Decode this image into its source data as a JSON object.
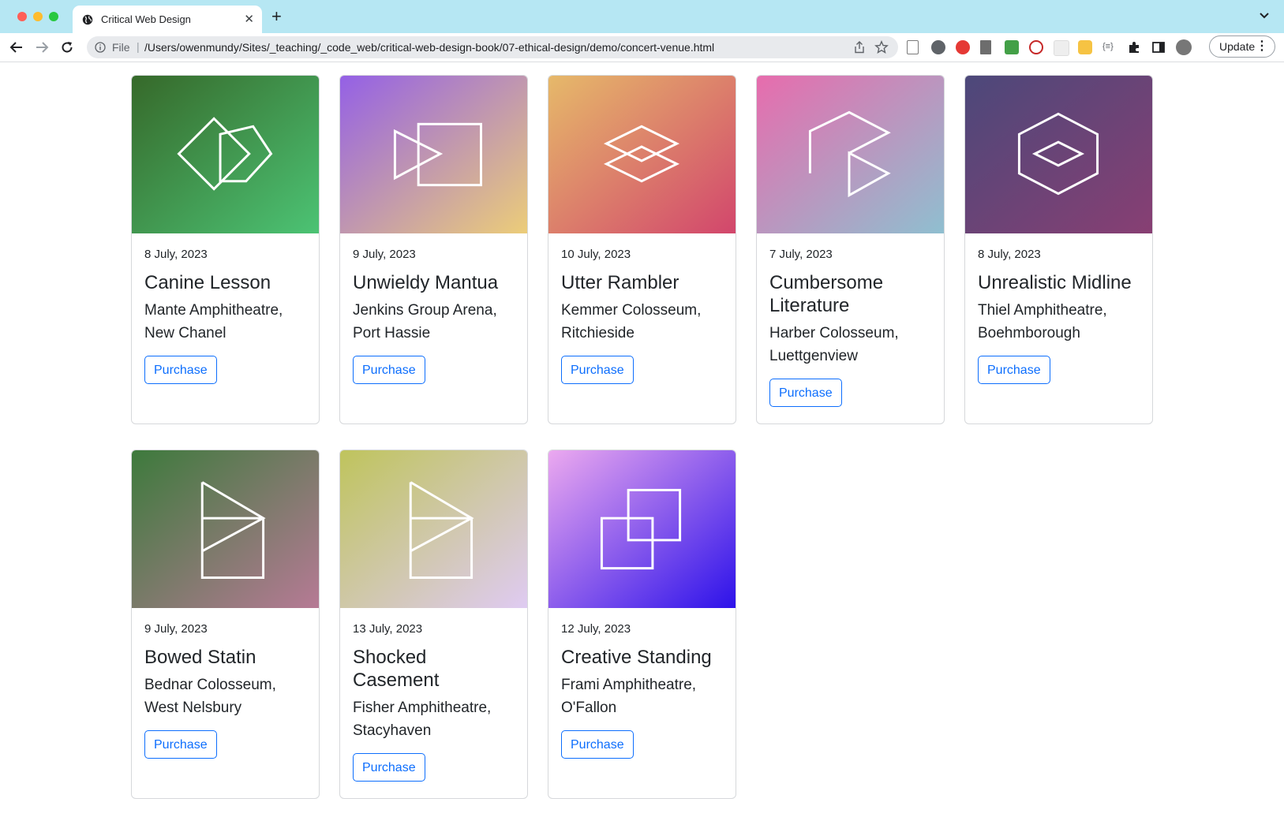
{
  "browser": {
    "tab_title": "Critical Web Design",
    "scheme": "File",
    "url": "/Users/owenmundy/Sites/_teaching/_code_web/critical-web-design-book/07-ethical-design/demo/concert-venue.html",
    "update_label": "Update"
  },
  "cards": [
    {
      "date": "8 July, 2023",
      "title": "Canine Lesson",
      "venue_line1": "Mante Amphitheatre,",
      "venue_line2": "New Chanel",
      "button": "Purchase",
      "gradient": [
        "#36692a",
        "#4cc374"
      ],
      "icon": "two-diamonds-icon"
    },
    {
      "date": "9 July, 2023",
      "title": "Unwieldy Mantua",
      "venue_line1": "Jenkins Group Arena,",
      "venue_line2": "Port Hassie",
      "button": "Purchase",
      "gradient": [
        "#9460e6",
        "#eccd79"
      ],
      "icon": "triangle-rectangle-icon"
    },
    {
      "date": "10 July, 2023",
      "title": "Utter Rambler",
      "venue_line1": "Kemmer Colosseum,",
      "venue_line2": "Ritchieside",
      "button": "Purchase",
      "gradient": [
        "#e6b96a",
        "#d2466c"
      ],
      "icon": "stacked-diamonds-icon"
    },
    {
      "date": "7 July, 2023",
      "title_line1": "Cumbersome",
      "title_line2": "Literature",
      "venue_line1": "Harber Colosseum,",
      "venue_line2": "Luettgenview",
      "button": "Purchase",
      "gradient": [
        "#e76cad",
        "#8fbfd0"
      ],
      "icon": "house-triangle-icon"
    },
    {
      "date": "8 July, 2023",
      "title": "Unrealistic Midline",
      "venue_line1": "Thiel Amphitheatre,",
      "venue_line2": "Boehmborough",
      "button": "Purchase",
      "gradient": [
        "#4c487a",
        "#883f73"
      ],
      "icon": "hexagon-diamond-icon"
    },
    {
      "date": "9 July, 2023",
      "title": "Bowed Statin",
      "venue_line1": "Bednar Colosseum,",
      "venue_line2": "West Nelsbury",
      "button": "Purchase",
      "gradient": [
        "#3d7a3c",
        "#b67a95"
      ],
      "icon": "flag-box-icon"
    },
    {
      "date": "13 July, 2023",
      "title_line1": "Shocked",
      "title_line2": "Casement",
      "venue_line1": "Fisher Amphitheatre,",
      "venue_line2": "Stacyhaven",
      "button": "Purchase",
      "gradient": [
        "#bfc45c",
        "#dfcbf2"
      ],
      "icon": "flag-box-icon"
    },
    {
      "date": "12 July, 2023",
      "title": "Creative Standing",
      "venue_line1": "Frami Amphitheatre,",
      "venue_line2": "O'Fallon",
      "button": "Purchase",
      "gradient": [
        "#eca9ef",
        "#2d12ea"
      ],
      "icon": "overlapping-squares-icon"
    }
  ]
}
